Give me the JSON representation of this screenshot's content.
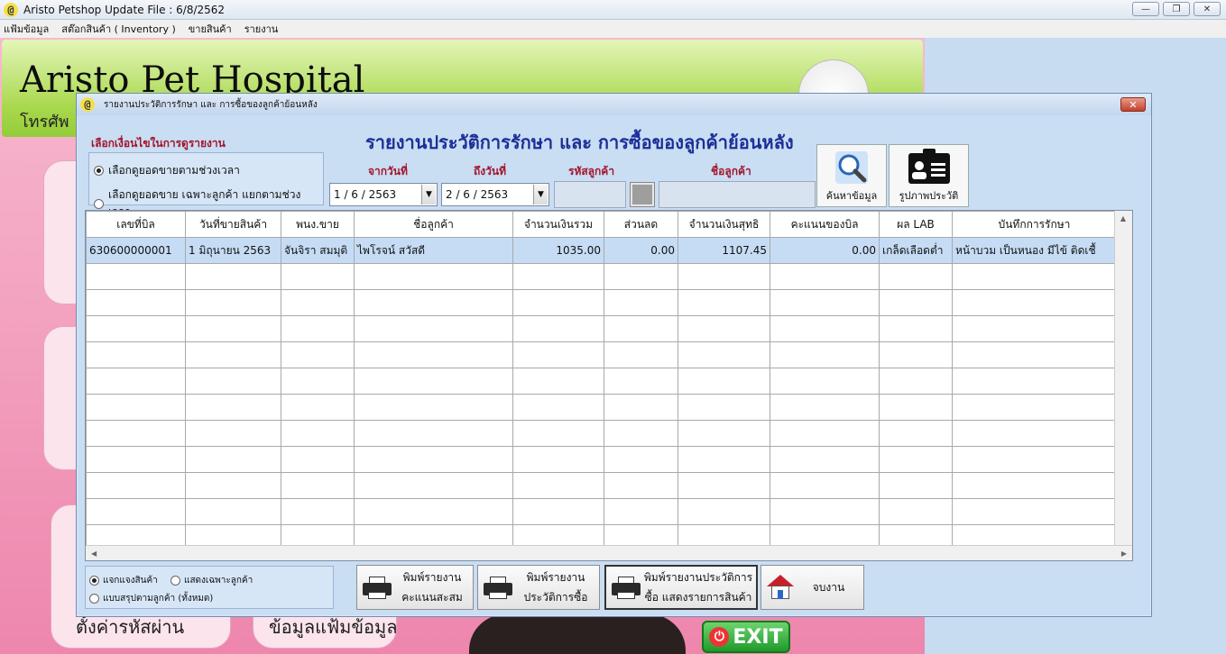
{
  "window": {
    "title": "Aristo Petshop  Update File : 6/8/2562",
    "buttons": [
      "—",
      "❐",
      "✕"
    ]
  },
  "menu": [
    "แฟ้มข้อมูล",
    "สต๊อกสินค้า ( Inventory )",
    "ขายสินค้า",
    "รายงาน"
  ],
  "background": {
    "hospital_name": "Aristo Pet Hospital",
    "phone_label": "โทรศัพ",
    "left_button_1": "ตั้งค่ารหัสผ่าน",
    "left_button_2": "ข้อมูลแฟ้มข้อมูล",
    "exit_label": "EXIT"
  },
  "dialog": {
    "title": "รายงานประวัติการรักษา และ การซื้อของลูกค้าย้อนหลัง",
    "close": "✕",
    "report_title": "รายงานประวัติการรักษา และ การซื้อของลูกค้าย้อนหลัง",
    "condition_title": "เลือกเงื่อนไขในการดูรายงาน",
    "condition_options": [
      {
        "label": "เลือกดูยอดขายตามช่วงเวลา",
        "selected": true
      },
      {
        "label": "เลือกดูยอดขาย เฉพาะลูกค้า แยกตามช่วงเวลา",
        "selected": false
      }
    ],
    "from_date_label": "จากวันที่",
    "from_date": "1 / 6 / 2563",
    "to_date_label": "ถึงวันที่",
    "to_date": "2 / 6 / 2563",
    "customer_code_label": "รหัสลูกค้า",
    "customer_code": "",
    "customer_name_label": "ชื่อลูกค้า",
    "customer_name": "",
    "search_button": "ค้นหาข้อมูล",
    "history_photo_button": "รูปภาพประวัติ"
  },
  "grid": {
    "columns": [
      "เลขที่บิล",
      "วันที่ขายสินค้า",
      "พนง.ขาย",
      "ชื่อลูกค้า",
      "จำนวนเงินรวม",
      "ส่วนลด",
      "จำนวนเงินสุทธิ",
      "คะแนนของบิล",
      "ผล LAB",
      "บันทึกการรักษา"
    ],
    "rows": [
      [
        "630600000001",
        "1 มิถุนายน 2563",
        "จันจิรา สมมุติ",
        "ไพโรจน์ สวัสดี",
        "1035.00",
        "0.00",
        "1107.45",
        "0.00",
        "เกล็ดเลือดต่ำ",
        "หน้าบวม เป็นหนอง มีไข้ ติดเชื้"
      ]
    ]
  },
  "bottom": {
    "options": [
      {
        "label": "แจกแจงสินค้า",
        "selected": true
      },
      {
        "label": "แสดงเฉพาะลูกค้า",
        "selected": false
      },
      {
        "label": "แบบสรุปตามลูกค้า (ทั้งหมด)",
        "selected": false
      }
    ],
    "print_points_line1": "พิมพ์รายงาน",
    "print_points_line2": "คะแนนสะสม",
    "print_history_line1": "พิมพ์รายงาน",
    "print_history_line2": "ประวัติการซื้อ",
    "print_full_line1": "พิมพ์รายงานประวัติการ",
    "print_full_line2": "ซื้อ แสดงรายการสินค้า",
    "close_button": "จบงาน"
  }
}
